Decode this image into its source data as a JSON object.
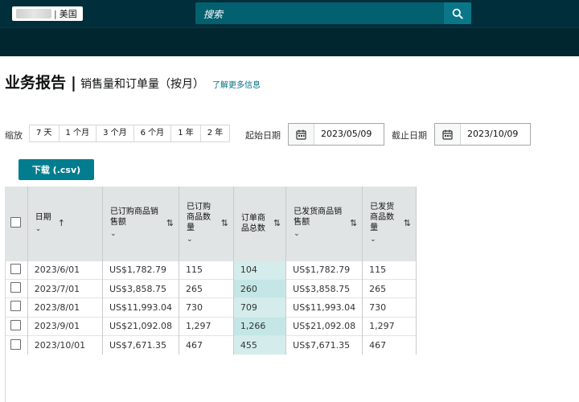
{
  "header": {
    "marketplace": "美国",
    "search_placeholder": "搜索",
    "search_icon": "search-icon"
  },
  "page": {
    "title": "业务报告",
    "subtitle": "销售量和订单量（按月）",
    "learn_more": "了解更多信息"
  },
  "filters": {
    "zoom_label": "缩放",
    "zoom_options": [
      "7 天",
      "1 个月",
      "3 个月",
      "6 个月",
      "1 年",
      "2 年"
    ],
    "start_label": "起始日期",
    "start_value": "2023/05/09",
    "end_label": "截止日期",
    "end_value": "2023/10/09"
  },
  "download_label": "下载 (.csv)",
  "table": {
    "columns": [
      {
        "label": "日期",
        "sort": "↑"
      },
      {
        "label": "已订购商品销售额",
        "sort": "⇅"
      },
      {
        "label": "已订购商品数量",
        "sort": "⇅"
      },
      {
        "label": "订单商品总数",
        "sort": "⇅"
      },
      {
        "label": "已发货商品销售额",
        "sort": "⇅"
      },
      {
        "label": "已发货商品数量",
        "sort": "⇅"
      }
    ],
    "rows": [
      [
        "2023/6/01",
        "US$1,782.79",
        "115",
        "104",
        "US$1,782.79",
        "115"
      ],
      [
        "2023/7/01",
        "US$3,858.75",
        "265",
        "260",
        "US$3,858.75",
        "265"
      ],
      [
        "2023/8/01",
        "US$11,993.04",
        "730",
        "709",
        "US$11,993.04",
        "730"
      ],
      [
        "2023/9/01",
        "US$21,092.08",
        "1,297",
        "1,266",
        "US$21,092.08",
        "1,297"
      ],
      [
        "2023/10/01",
        "US$7,671.35",
        "467",
        "455",
        "US$7,671.35",
        "467"
      ]
    ]
  }
}
